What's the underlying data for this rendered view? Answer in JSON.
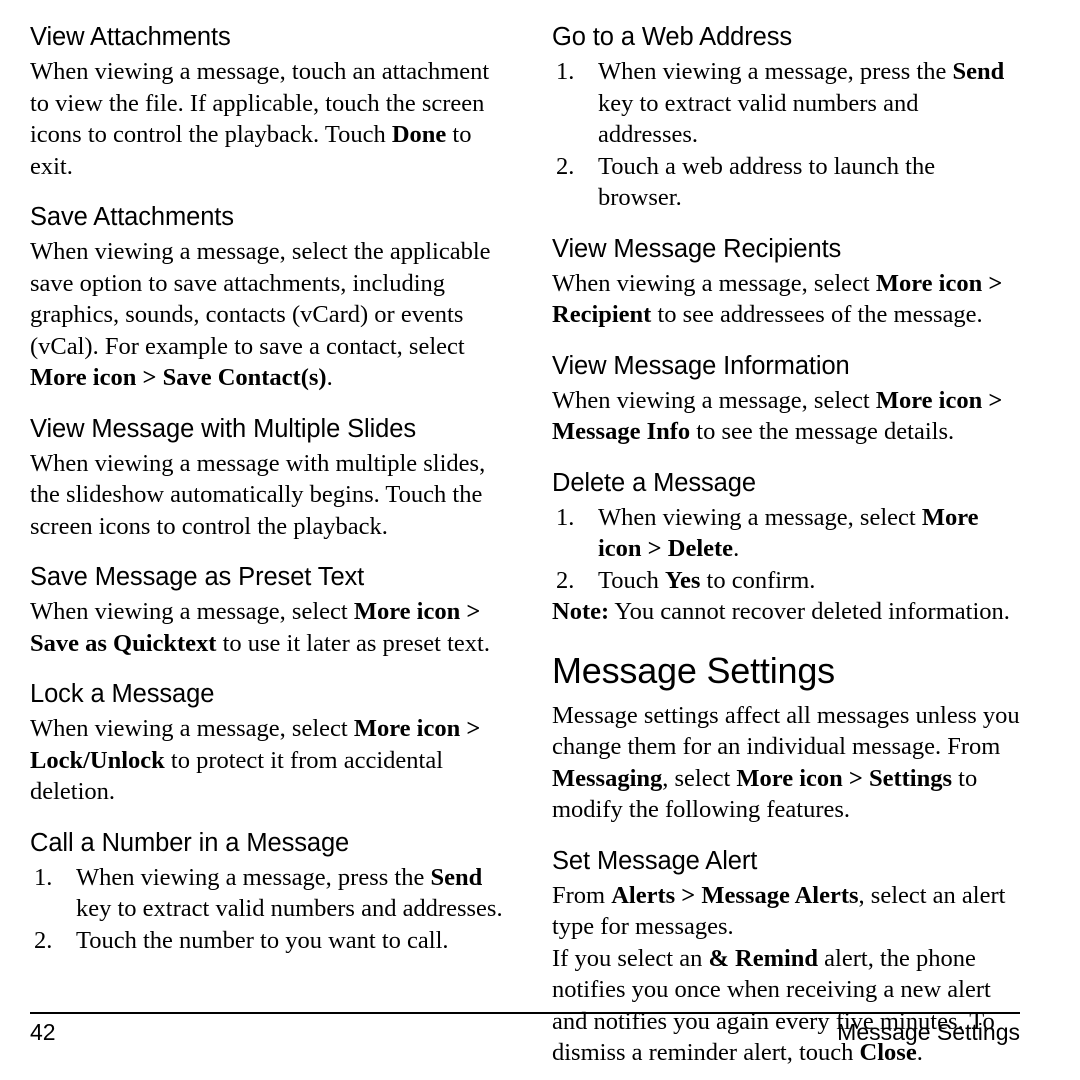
{
  "document": {
    "left_column": [
      {
        "type": "section",
        "heading": "View Attachments",
        "paragraphs": [
          [
            {
              "t": "When viewing a message, touch an attachment to view the file. If applicable, touch the screen icons to control the playback. Touch ",
              "b": false
            },
            {
              "t": "Done",
              "b": true
            },
            {
              "t": " to exit.",
              "b": false
            }
          ]
        ]
      },
      {
        "type": "section",
        "heading": "Save Attachments",
        "paragraphs": [
          [
            {
              "t": "When viewing a message, select the applicable save option to save attachments, including graphics, sounds, contacts (vCard) or events (vCal). For example to save a contact, select ",
              "b": false
            },
            {
              "t": "More icon > Save Contact(s)",
              "b": true
            },
            {
              "t": ".",
              "b": false
            }
          ]
        ]
      },
      {
        "type": "section",
        "heading": "View Message with Multiple Slides",
        "paragraphs": [
          [
            {
              "t": "When viewing a message with multiple slides, the slideshow automatically begins. Touch the screen icons to control the playback.",
              "b": false
            }
          ]
        ]
      },
      {
        "type": "section",
        "heading": "Save Message as Preset Text",
        "paragraphs": [
          [
            {
              "t": "When viewing a message, select ",
              "b": false
            },
            {
              "t": "More icon > Save as Quicktext",
              "b": true
            },
            {
              "t": " to use it later as preset text.",
              "b": false
            }
          ]
        ]
      },
      {
        "type": "section",
        "heading": "Lock a Message",
        "paragraphs": [
          [
            {
              "t": "When viewing a message, select ",
              "b": false
            },
            {
              "t": "More icon > Lock/Unlock",
              "b": true
            },
            {
              "t": " to protect it from accidental deletion.",
              "b": false
            }
          ]
        ]
      },
      {
        "type": "section-list",
        "heading": "Call a Number in a Message",
        "steps": [
          [
            {
              "t": "When viewing a message, press the ",
              "b": false
            },
            {
              "t": "Send",
              "b": true
            },
            {
              "t": " key to extract valid numbers and addresses.",
              "b": false
            }
          ],
          [
            {
              "t": "Touch the number to you want to call.",
              "b": false
            }
          ]
        ]
      }
    ],
    "right_column": [
      {
        "type": "section-list",
        "heading": "Go to a Web Address",
        "steps": [
          [
            {
              "t": "When viewing a message, press the ",
              "b": false
            },
            {
              "t": "Send",
              "b": true
            },
            {
              "t": " key to extract valid numbers and addresses.",
              "b": false
            }
          ],
          [
            {
              "t": "Touch a web address to launch the browser.",
              "b": false
            }
          ]
        ]
      },
      {
        "type": "section",
        "heading": "View Message Recipients",
        "paragraphs": [
          [
            {
              "t": "When viewing a message, select ",
              "b": false
            },
            {
              "t": "More icon > Recipient",
              "b": true
            },
            {
              "t": " to see addressees of the message.",
              "b": false
            }
          ]
        ]
      },
      {
        "type": "section",
        "heading": "View Message Information",
        "paragraphs": [
          [
            {
              "t": "When viewing a message, select ",
              "b": false
            },
            {
              "t": "More icon > Message Info",
              "b": true
            },
            {
              "t": " to see the message details.",
              "b": false
            }
          ]
        ]
      },
      {
        "type": "section-list",
        "heading": "Delete a Message",
        "steps": [
          [
            {
              "t": "When viewing a message, select ",
              "b": false
            },
            {
              "t": "More icon > Delete",
              "b": true
            },
            {
              "t": ".",
              "b": false
            }
          ],
          [
            {
              "t": "Touch ",
              "b": false
            },
            {
              "t": "Yes",
              "b": true
            },
            {
              "t": " to confirm.",
              "b": false
            }
          ]
        ],
        "after_paragraphs": [
          [
            {
              "t": "Note:",
              "b": true
            },
            {
              "t": " You cannot recover deleted information.",
              "b": false
            }
          ]
        ]
      },
      {
        "type": "chapter",
        "heading": "Message Settings",
        "paragraphs": [
          [
            {
              "t": "Message settings affect all messages unless you change them for an individual message. From ",
              "b": false
            },
            {
              "t": "Messaging",
              "b": true
            },
            {
              "t": ", select ",
              "b": false
            },
            {
              "t": "More icon > Settings",
              "b": true
            },
            {
              "t": " to modify the following features.",
              "b": false
            }
          ]
        ]
      },
      {
        "type": "section",
        "heading": "Set Message Alert",
        "paragraphs": [
          [
            {
              "t": "From ",
              "b": false
            },
            {
              "t": "Alerts > Message Alerts",
              "b": true
            },
            {
              "t": ", select an alert type for messages.",
              "b": false
            }
          ],
          [
            {
              "t": "If you select an ",
              "b": false
            },
            {
              "t": "& Remind",
              "b": true
            },
            {
              "t": " alert, the phone notifies you once when receiving a new alert and notifies you again every five minutes. To dismiss a reminder alert, touch ",
              "b": false
            },
            {
              "t": "Close",
              "b": true
            },
            {
              "t": ".",
              "b": false
            }
          ]
        ]
      }
    ]
  },
  "footer": {
    "page_number": "42",
    "running_head": "Message Settings"
  }
}
